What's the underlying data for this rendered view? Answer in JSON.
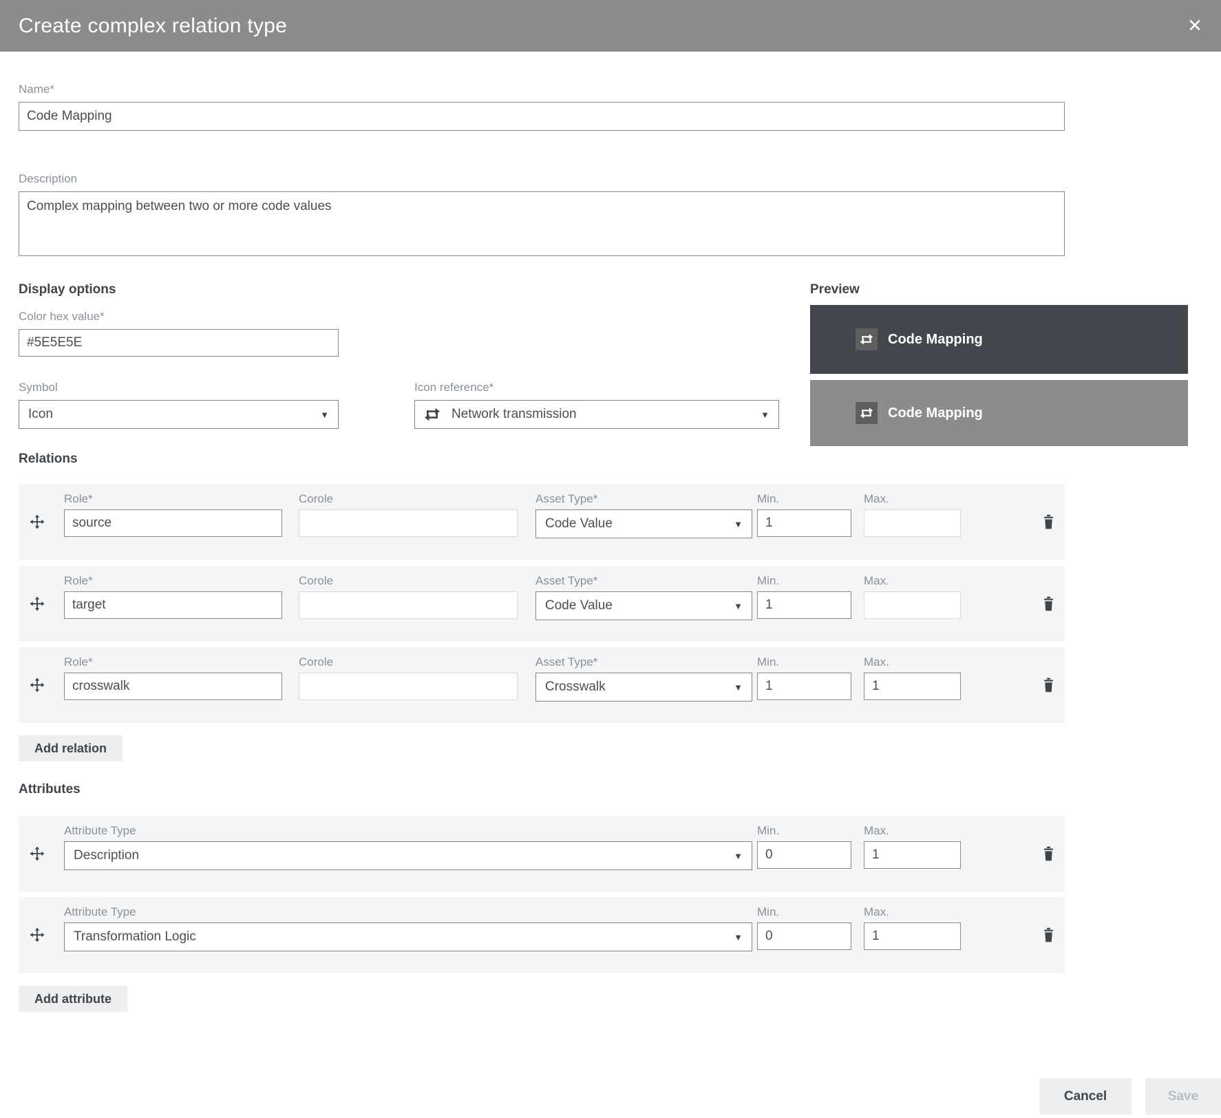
{
  "modal": {
    "title": "Create complex relation type"
  },
  "icons": {
    "close": "✕",
    "dropdown_caret": "▼"
  },
  "colors": {
    "header_background": "#8C8C8C",
    "accent_dark": "#3F454B",
    "row_background": "#F4F5F6",
    "button_background": "#ECEEF0"
  },
  "fields": {
    "name": {
      "label": "Name*",
      "value": "Code Mapping"
    },
    "description": {
      "label": "Description",
      "value": "Complex mapping between two or more code values"
    }
  },
  "display_options": {
    "heading": "Display options",
    "color_hex": {
      "label": "Color hex value*",
      "value": "#5E5E5E"
    },
    "symbol": {
      "label": "Symbol",
      "value": "Icon"
    },
    "icon_reference": {
      "label": "Icon reference*",
      "value": "Network transmission"
    }
  },
  "preview": {
    "heading": "Preview",
    "tiles": [
      {
        "label": "Code Mapping",
        "background": "#42474D",
        "badge": "#5E5E5E"
      },
      {
        "label": "Code Mapping",
        "background": "#8C8C8C",
        "badge": "#5E5E5E"
      }
    ]
  },
  "relations": {
    "heading": "Relations",
    "columns": {
      "role": "Role*",
      "corole": "Corole",
      "asset_type": "Asset Type*",
      "min": "Min.",
      "max": "Max."
    },
    "rows": [
      {
        "role": "source",
        "corole": "",
        "asset_type": "Code Value",
        "min": "1",
        "max": ""
      },
      {
        "role": "target",
        "corole": "",
        "asset_type": "Code Value",
        "min": "1",
        "max": ""
      },
      {
        "role": "crosswalk",
        "corole": "",
        "asset_type": "Crosswalk",
        "min": "1",
        "max": "1"
      }
    ],
    "add_button": "Add relation"
  },
  "attributes": {
    "heading": "Attributes",
    "columns": {
      "attribute_type": "Attribute Type",
      "min": "Min.",
      "max": "Max."
    },
    "rows": [
      {
        "attribute_type": "Description",
        "min": "0",
        "max": "1"
      },
      {
        "attribute_type": "Transformation Logic",
        "min": "0",
        "max": "1"
      }
    ],
    "add_button": "Add attribute"
  },
  "footer": {
    "cancel_label": "Cancel",
    "save_label": "Save"
  }
}
